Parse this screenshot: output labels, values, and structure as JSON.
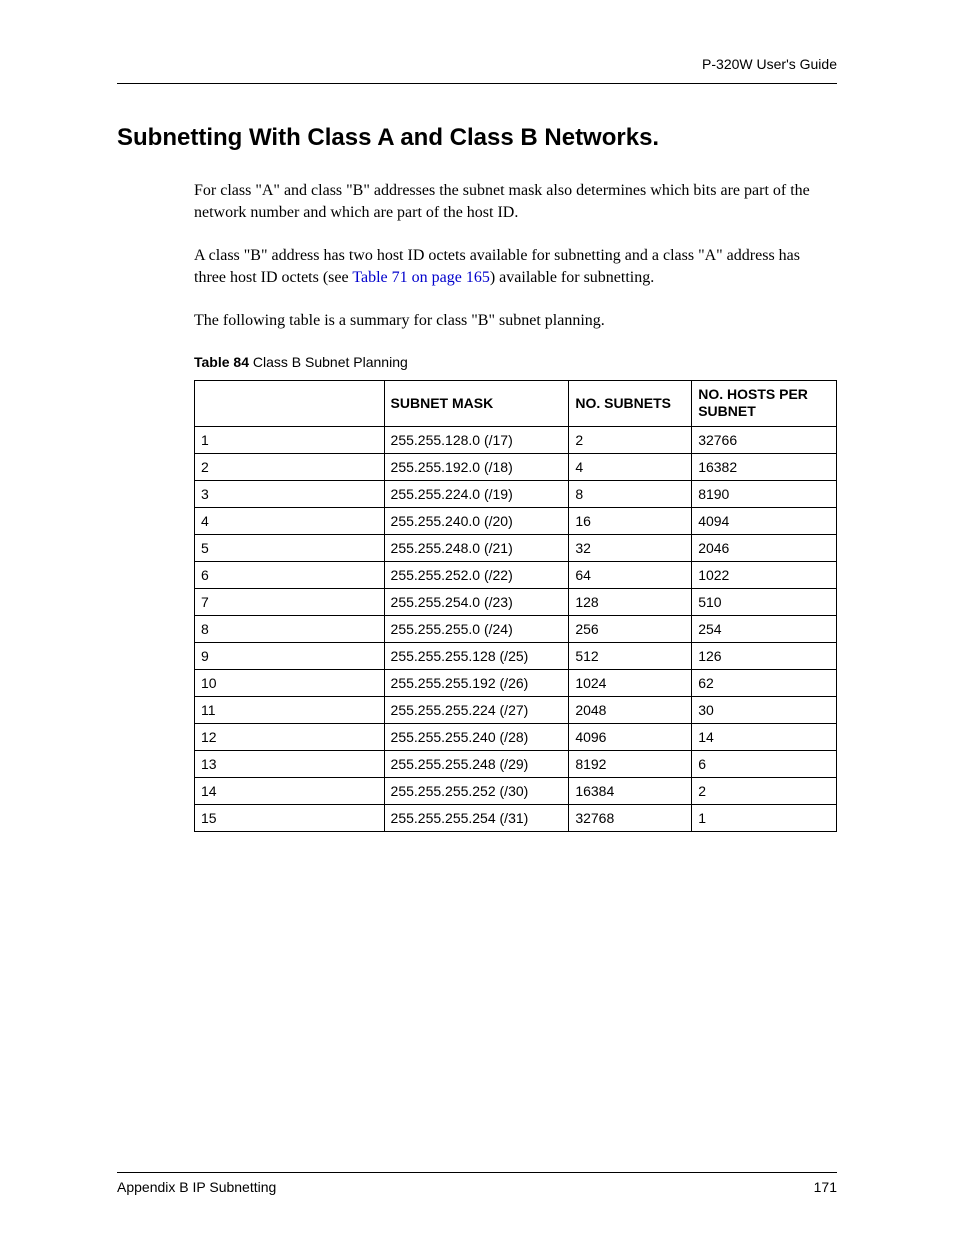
{
  "header": {
    "guide": "P-320W User's Guide"
  },
  "section_title": "Subnetting With Class A and Class B Networks.",
  "para1": "For class \"A\" and class \"B\" addresses the subnet mask also determines which bits are part of the network number and which are part of the host ID.",
  "para2_a": "A class \"B\" address has two host ID octets available for subnetting and a class \"A\" address has three host ID octets (see ",
  "para2_link": "Table 71 on page 165",
  "para2_b": ") available for subnetting.",
  "para3": "The following table is a summary for class \"B\" subnet planning.",
  "table_caption_label": "Table 84",
  "table_caption_text": "   Class B Subnet Planning",
  "columns": {
    "c1": "",
    "c2": "SUBNET MASK",
    "c3": "NO. SUBNETS",
    "c4": "NO. HOSTS PER SUBNET"
  },
  "rows": [
    {
      "bits": "1",
      "mask": "255.255.128.0 (/17)",
      "subnets": "2",
      "hosts": "32766"
    },
    {
      "bits": "2",
      "mask": "255.255.192.0 (/18)",
      "subnets": "4",
      "hosts": "16382"
    },
    {
      "bits": "3",
      "mask": "255.255.224.0 (/19)",
      "subnets": "8",
      "hosts": "8190"
    },
    {
      "bits": "4",
      "mask": "255.255.240.0 (/20)",
      "subnets": "16",
      "hosts": "4094"
    },
    {
      "bits": "5",
      "mask": "255.255.248.0 (/21)",
      "subnets": "32",
      "hosts": "2046"
    },
    {
      "bits": "6",
      "mask": "255.255.252.0 (/22)",
      "subnets": "64",
      "hosts": "1022"
    },
    {
      "bits": "7",
      "mask": "255.255.254.0 (/23)",
      "subnets": "128",
      "hosts": "510"
    },
    {
      "bits": "8",
      "mask": "255.255.255.0 (/24)",
      "subnets": "256",
      "hosts": "254"
    },
    {
      "bits": "9",
      "mask": "255.255.255.128 (/25)",
      "subnets": "512",
      "hosts": "126"
    },
    {
      "bits": "10",
      "mask": "255.255.255.192 (/26)",
      "subnets": "1024",
      "hosts": "62"
    },
    {
      "bits": "11",
      "mask": "255.255.255.224 (/27)",
      "subnets": "2048",
      "hosts": "30"
    },
    {
      "bits": "12",
      "mask": "255.255.255.240 (/28)",
      "subnets": "4096",
      "hosts": "14"
    },
    {
      "bits": "13",
      "mask": "255.255.255.248 (/29)",
      "subnets": "8192",
      "hosts": "6"
    },
    {
      "bits": "14",
      "mask": "255.255.255.252 (/30)",
      "subnets": "16384",
      "hosts": "2"
    },
    {
      "bits": "15",
      "mask": "255.255.255.254 (/31)",
      "subnets": "32768",
      "hosts": "1"
    }
  ],
  "footer": {
    "left": "Appendix B IP Subnetting",
    "right": "171"
  }
}
